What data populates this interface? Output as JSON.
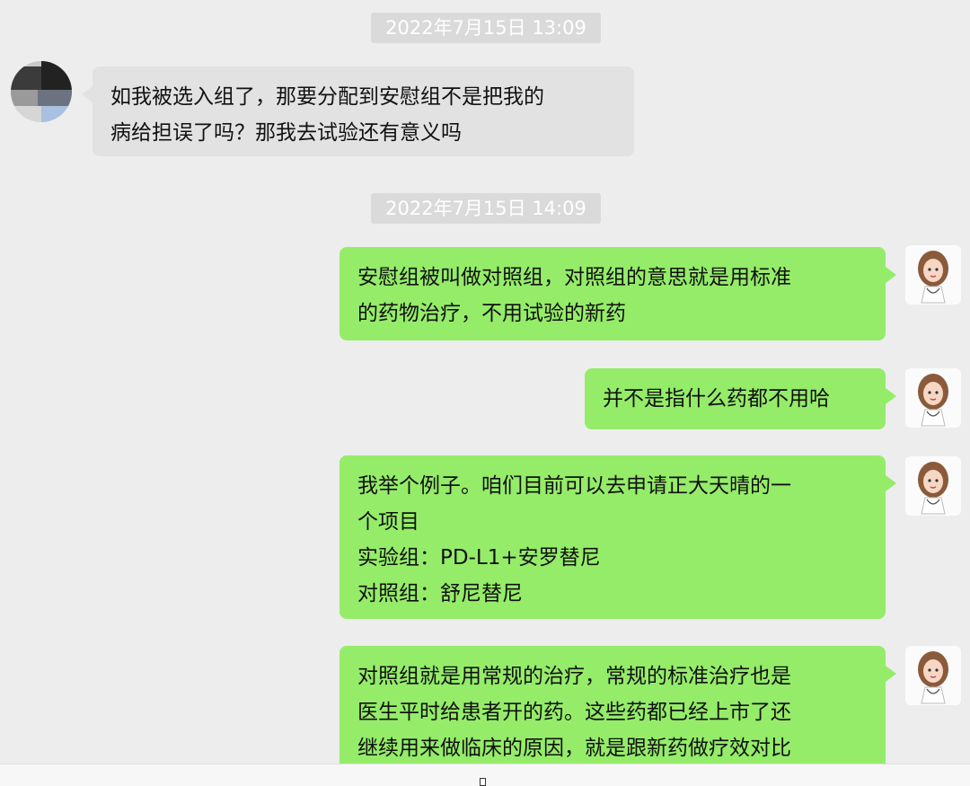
{
  "chat": {
    "timestamps": [
      "2022年7月15日 13:09",
      "2022年7月15日 14:09"
    ],
    "messages": [
      {
        "sender": "patient",
        "lines": [
          "如我被选入组了，那要分配到安慰组不是把我的",
          "病给担误了吗？那我去试验还有意义吗"
        ]
      },
      {
        "sender": "doctor",
        "lines": [
          "安慰组被叫做对照组，对照组的意思就是用标准",
          "的药物治疗，不用试验的新药"
        ]
      },
      {
        "sender": "doctor",
        "lines": [
          "并不是指什么药都不用哈"
        ]
      },
      {
        "sender": "doctor",
        "lines": [
          "我举个例子。咱们目前可以去申请正大天晴的一",
          "个项目",
          "实验组：PD-L1+安罗替尼",
          "对照组：舒尼替尼"
        ]
      },
      {
        "sender": "doctor",
        "lines": [
          "对照组就是用常规的治疗，常规的标准治疗也是",
          "医生平时给患者开的药。这些药都已经上市了还",
          "继续用来做临床的原因，就是跟新药做疗效对比"
        ]
      }
    ]
  },
  "colors": {
    "background": "#ededed",
    "outgoing_bubble": "#95ec69",
    "incoming_bubble": "#e2e2e2",
    "timestamp_bg": "#dadada"
  },
  "icons": {
    "patient_avatar": "pixelated-avatar",
    "doctor_avatar": "cartoon-doctor-avatar"
  }
}
